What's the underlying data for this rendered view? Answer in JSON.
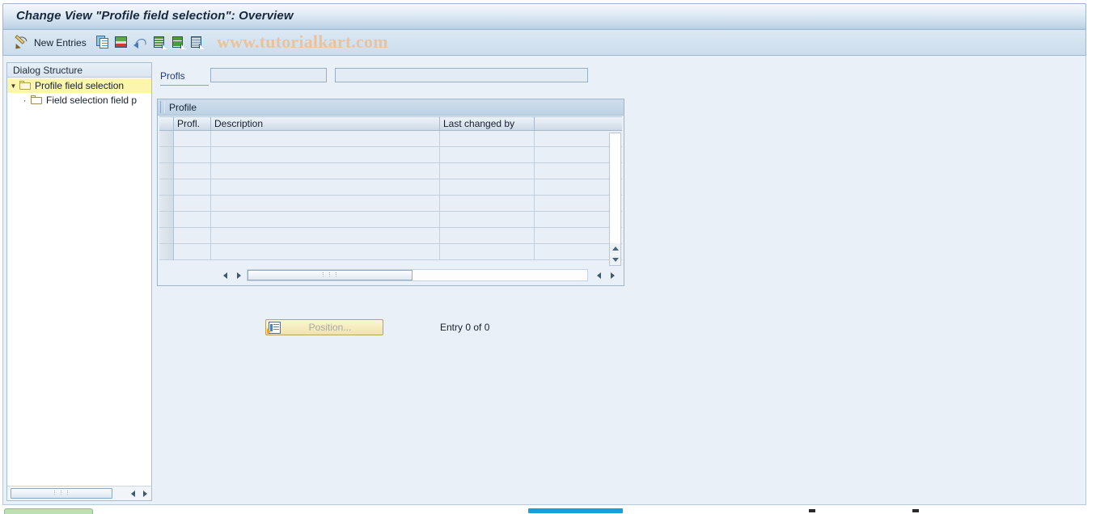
{
  "window": {
    "title": "Change View \"Profile field selection\": Overview"
  },
  "toolbar": {
    "icons": [
      {
        "name": "display-change-icon",
        "label": ""
      },
      {
        "name": "new-entries-button",
        "label": "New Entries"
      },
      {
        "name": "copy-as-icon",
        "label": ""
      },
      {
        "name": "delete-icon",
        "label": ""
      },
      {
        "name": "undo-icon",
        "label": ""
      },
      {
        "name": "select-all-icon",
        "label": ""
      },
      {
        "name": "deselect-all-icon",
        "label": ""
      },
      {
        "name": "select-block-icon",
        "label": ""
      }
    ],
    "new_entries_label": "New Entries",
    "watermark": "www.tutorialkart.com",
    "watermark_color": "#efc194"
  },
  "sidebar": {
    "header": "Dialog Structure",
    "items": [
      {
        "label": "Profile field selection",
        "selected": true,
        "expanded": true,
        "level": 0,
        "icon": "open-folder-icon"
      },
      {
        "label": "Field selection field p",
        "selected": false,
        "expanded": false,
        "level": 1,
        "icon": "folder-icon"
      }
    ],
    "selection_color": "#fbf5ae"
  },
  "main": {
    "profls": {
      "label": "Profls",
      "value_1": "",
      "value_2": "",
      "placeholder_1": "",
      "placeholder_2": ""
    },
    "table": {
      "caption": "Profile",
      "columns": [
        "Profl.",
        "Description",
        "Last changed by"
      ],
      "rows": [
        [
          "",
          "",
          ""
        ],
        [
          "",
          "",
          ""
        ],
        [
          "",
          "",
          ""
        ],
        [
          "",
          "",
          ""
        ],
        [
          "",
          "",
          ""
        ],
        [
          "",
          "",
          ""
        ],
        [
          "",
          "",
          ""
        ],
        [
          "",
          "",
          ""
        ]
      ],
      "settings_icon": "table-settings-icon"
    },
    "position_button": {
      "label": "Position...",
      "enabled": false,
      "icon": "position-icon"
    },
    "entry_status": "Entry 0 of 0"
  },
  "status_strip": {
    "green_indicator_color": "#bcdfb4",
    "blue_indicator_color": "#13a0e0"
  }
}
